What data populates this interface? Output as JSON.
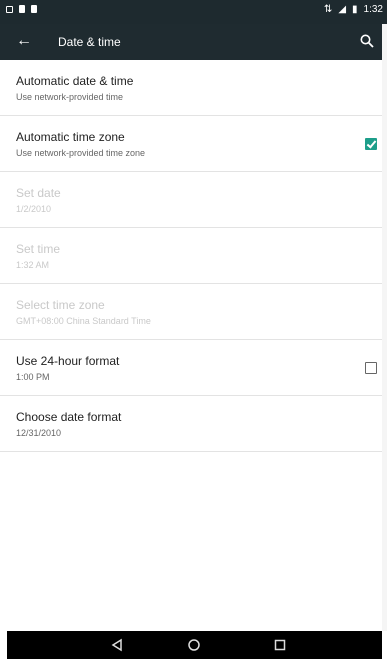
{
  "status_bar": {
    "time": "1:32",
    "icons": [
      "notification-icon",
      "notification-icon",
      "notification-icon",
      "sync-icon",
      "signal-icon",
      "battery-icon"
    ]
  },
  "toolbar": {
    "title": "Date & time",
    "back_icon": "back-arrow-icon",
    "search_icon": "search-icon"
  },
  "settings": [
    {
      "title": "Automatic date & time",
      "subtitle": "Use network-provided time",
      "enabled": true
    },
    {
      "title": "Automatic time zone",
      "subtitle": "Use network-provided time zone",
      "enabled": true,
      "checked": true
    },
    {
      "title": "Set date",
      "subtitle": "1/2/2010",
      "enabled": false
    },
    {
      "title": "Set time",
      "subtitle": "1:32 AM",
      "enabled": false
    },
    {
      "title": "Select time zone",
      "subtitle": "GMT+08:00 China Standard Time",
      "enabled": false
    },
    {
      "title": "Use 24-hour format",
      "subtitle": "1:00 PM",
      "enabled": true,
      "checked": false
    },
    {
      "title": "Choose date format",
      "subtitle": "12/31/2010",
      "enabled": true
    }
  ],
  "nav_bar": {
    "icons": [
      "back-triangle-icon",
      "home-circle-icon",
      "recents-square-icon"
    ]
  },
  "colors": {
    "toolbar": "#1f2b30",
    "accent": "#1d9e8a"
  }
}
